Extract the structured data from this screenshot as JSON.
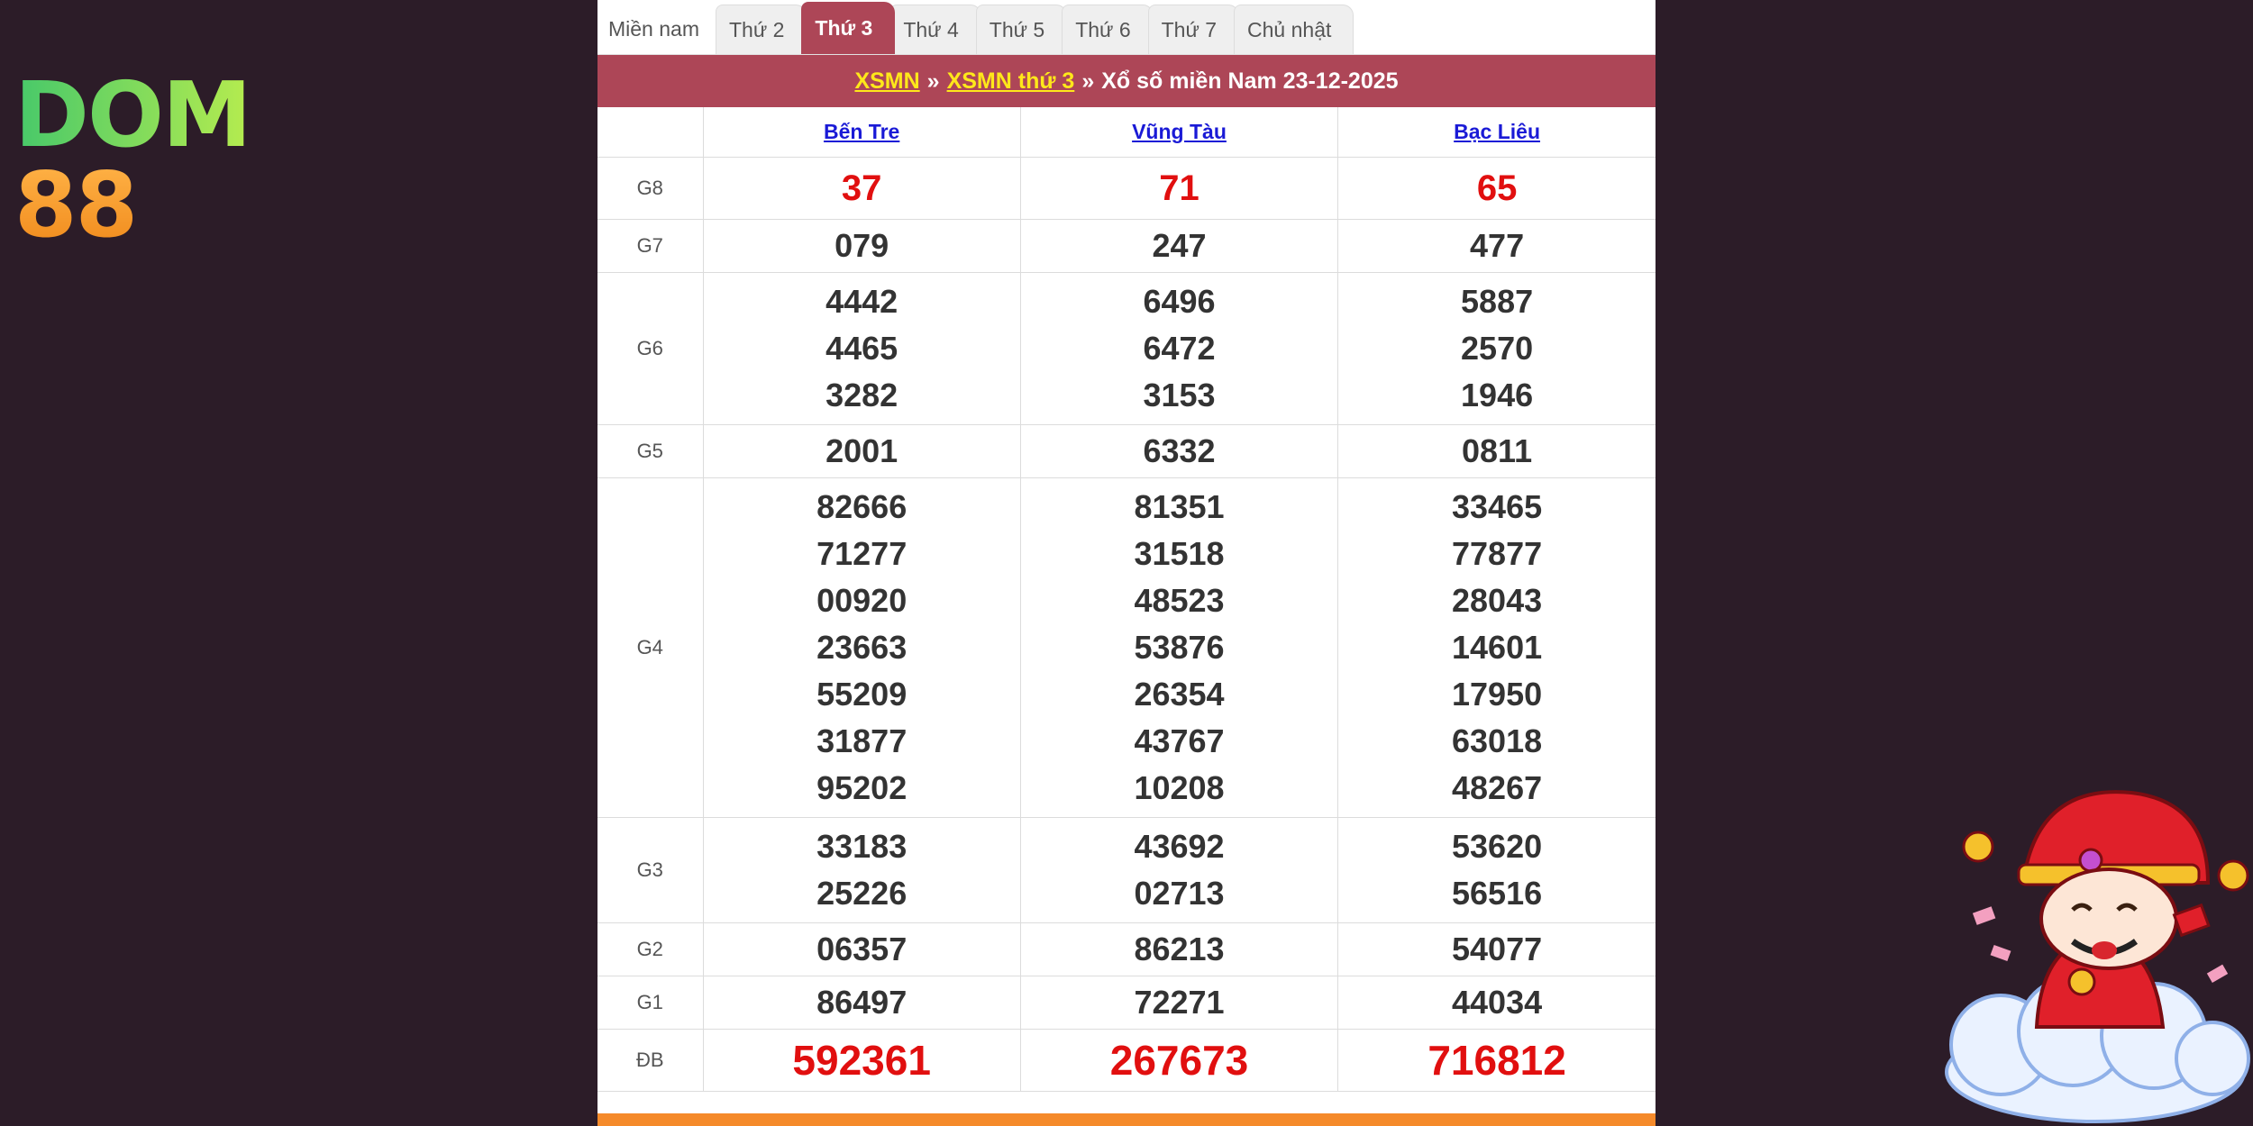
{
  "logo": {
    "part1": "DOM",
    "part2": "88"
  },
  "tabs": [
    {
      "label": "Miền nam",
      "active": false
    },
    {
      "label": "Thứ 2",
      "active": false
    },
    {
      "label": "Thứ 3",
      "active": true
    },
    {
      "label": "Thứ 4",
      "active": false
    },
    {
      "label": "Thứ 5",
      "active": false
    },
    {
      "label": "Thứ 6",
      "active": false
    },
    {
      "label": "Thứ 7",
      "active": false
    },
    {
      "label": "Chủ nhật",
      "active": false
    }
  ],
  "breadcrumb": {
    "link1": "XSMN",
    "separator": "»",
    "link2": "XSMN thứ 3",
    "text": "Xổ số miền Nam 23-12-2025"
  },
  "provinces": [
    "Bến Tre",
    "Vũng Tàu",
    "Bạc Liêu"
  ],
  "prizes": [
    {
      "label": "G8",
      "style": "red",
      "values": [
        [
          "37"
        ],
        [
          "71"
        ],
        [
          "65"
        ]
      ]
    },
    {
      "label": "G7",
      "style": "",
      "values": [
        [
          "079"
        ],
        [
          "247"
        ],
        [
          "477"
        ]
      ]
    },
    {
      "label": "G6",
      "style": "",
      "values": [
        [
          "4442",
          "4465",
          "3282"
        ],
        [
          "6496",
          "6472",
          "3153"
        ],
        [
          "5887",
          "2570",
          "1946"
        ]
      ]
    },
    {
      "label": "G5",
      "style": "",
      "values": [
        [
          "2001"
        ],
        [
          "6332"
        ],
        [
          "0811"
        ]
      ]
    },
    {
      "label": "G4",
      "style": "",
      "values": [
        [
          "82666",
          "71277",
          "00920",
          "23663",
          "55209",
          "31877",
          "95202"
        ],
        [
          "81351",
          "31518",
          "48523",
          "53876",
          "26354",
          "43767",
          "10208"
        ],
        [
          "33465",
          "77877",
          "28043",
          "14601",
          "17950",
          "63018",
          "48267"
        ]
      ]
    },
    {
      "label": "G3",
      "style": "",
      "values": [
        [
          "33183",
          "25226"
        ],
        [
          "43692",
          "02713"
        ],
        [
          "53620",
          "56516"
        ]
      ]
    },
    {
      "label": "G2",
      "style": "",
      "values": [
        [
          "06357"
        ],
        [
          "86213"
        ],
        [
          "54077"
        ]
      ]
    },
    {
      "label": "G1",
      "style": "",
      "values": [
        [
          "86497"
        ],
        [
          "72271"
        ],
        [
          "44034"
        ]
      ]
    },
    {
      "label": "ĐB",
      "style": "db",
      "values": [
        [
          "592361"
        ],
        [
          "267673"
        ],
        [
          "716812"
        ]
      ]
    }
  ],
  "colors": {
    "background": "#2c1c28",
    "header": "#ad4657",
    "link_yellow": "#ffe81a",
    "prize_red": "#e10f0f",
    "province_link": "#1a1ad6",
    "bottom_bar": "#f58a2a"
  },
  "icons": {
    "mascot": "god-of-wealth-mascot-icon"
  }
}
